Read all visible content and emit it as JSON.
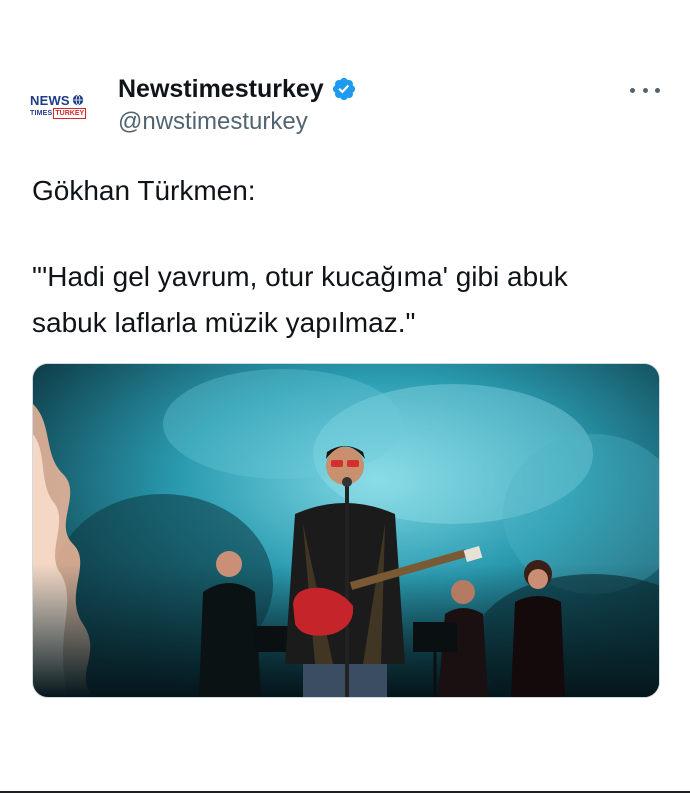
{
  "author": {
    "display_name": "Newstimesturkey",
    "handle": "@nwstimesturkey",
    "verified": true,
    "avatar_logo": {
      "line1": "NEWS",
      "line2_a": "TIMES",
      "line2_b": "TURKEY"
    }
  },
  "tweet": {
    "line1": "Gökhan Türkmen:",
    "line2": "\"'Hadi gel yavrum, otur kucağıma' gibi abuk",
    "line3": "sabuk laflarla müzik yapılmaz.\""
  },
  "icons": {
    "verified": "verified-badge-icon",
    "more": "more-options-icon"
  },
  "colors": {
    "verified_blue": "#1d9bf0",
    "text": "#0f1419",
    "secondary": "#536471",
    "stage_smoke": "#3fb6c9"
  }
}
